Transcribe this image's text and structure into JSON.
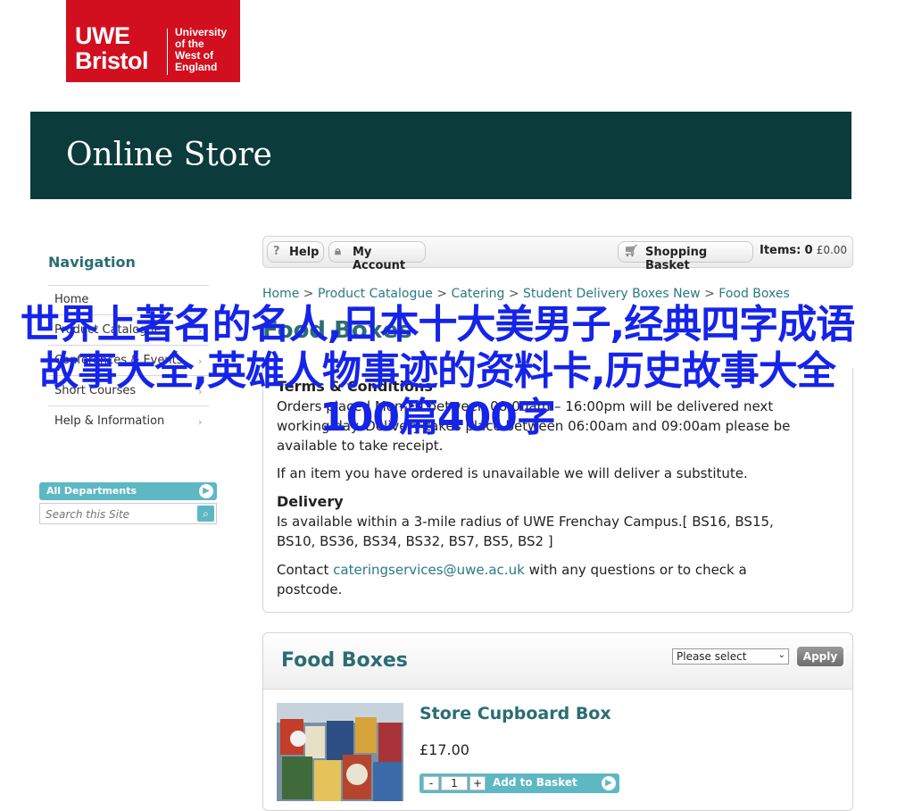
{
  "logo": {
    "line1": "UWE",
    "line2": "Bristol",
    "uni_lines": [
      "University",
      "of the",
      "West of",
      "England"
    ]
  },
  "banner": {
    "title": "Online Store"
  },
  "sidebar": {
    "title": "Navigation",
    "items": [
      {
        "label": "Home"
      },
      {
        "label": "Product Catalogue"
      },
      {
        "label": "Conferences & Events"
      },
      {
        "label": "Short Courses"
      },
      {
        "label": "Help & Information"
      }
    ],
    "departments_label": "All Departments",
    "search_placeholder": "Search this Site"
  },
  "toolbar": {
    "help_label": "Help",
    "account_label": "My Account",
    "basket_label": "Shopping Basket",
    "items_label": "Items:",
    "items_count": "0",
    "items_total": "£0.00"
  },
  "breadcrumb": {
    "items": [
      "Home",
      "Product Catalogue",
      "Catering",
      "Student Delivery Boxes New",
      "Food Boxes"
    ],
    "separator": ">"
  },
  "page": {
    "title": "Food Boxes",
    "terms_heading": "Terms & Conditions",
    "terms_text": "Orders placed Mon-Fri between 08:00am – 16:00pm will be delivered next working day. Delivery takes place between 06:00am and 09:00am please be available to take receipt.",
    "substitute_text": "If an item you have ordered is unavailable we will deliver a substitute.",
    "delivery_heading": "Delivery",
    "delivery_text_1": "Is available within a 3-mile radius of UWE Frenchay Campus.[ BS16, BS15,",
    "delivery_text_2": "BS10, BS36, BS34, BS32, BS7, BS5, BS2 ]",
    "contact_prefix": "Contact",
    "contact_email": "cateringservices@uwe.ac.uk",
    "contact_suffix": "with any questions or to check a",
    "contact_suffix_2": "postcode."
  },
  "overlay": {
    "text": "世界上著名的名人,日本十大美男子,经典四字成语故事大全,英雄人物事迹的资料卡,历史故事大全100篇400字",
    "color": "#1524e8"
  },
  "listing": {
    "title": "Food Boxes",
    "sort_value": "Please select",
    "apply_label": "Apply",
    "product": {
      "name": "Store Cupboard Box",
      "price": "£17.00",
      "quantity": "1",
      "minus": "-",
      "plus": "+",
      "add_label": "Add to Basket"
    }
  },
  "colors": {
    "brand_red": "#d20f1e",
    "banner": "#0b3b3b",
    "accent_teal": "#2a6d73",
    "button_teal": "#5db8c4"
  }
}
